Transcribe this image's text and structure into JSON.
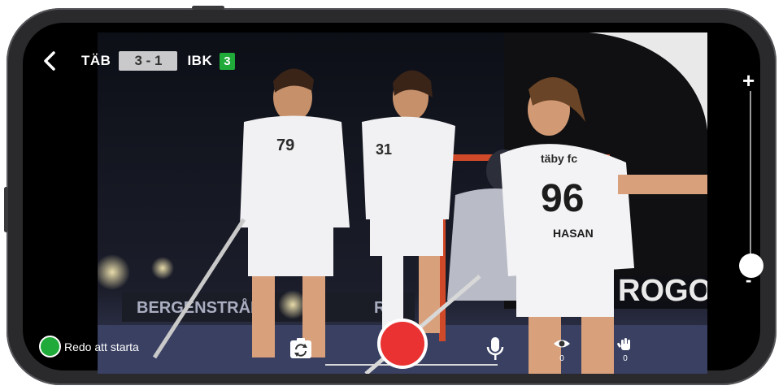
{
  "scoreboard": {
    "home_team": "TÄB",
    "score": "3 - 1",
    "away_team": "IBK",
    "period": "3"
  },
  "status": {
    "label": "Redo att starta",
    "color": "#1faa3a"
  },
  "counters": {
    "viewers": "0",
    "reactions": "0"
  },
  "icons": {
    "back": "chevron-left-icon",
    "switch_camera": "camera-rotate-icon",
    "record": "record-button",
    "mic": "microphone-icon",
    "viewers": "eye-icon",
    "reactions": "hand-icon",
    "zoom_in": "plus-icon",
    "zoom_out": "minus-icon"
  },
  "scene": {
    "jersey_front_left": "79",
    "jersey_middle": "31",
    "jersey_right": "96",
    "jersey_right_name": "HASAN",
    "jersey_right_club": "täby fc",
    "banner_left": "BERGENSTRÅLE",
    "banner_left_tail": "RS",
    "banner_right": "ROGON"
  },
  "zoom": {
    "level": 0.0
  },
  "colors": {
    "record": "#ea3232",
    "status_ok": "#1faa3a",
    "score_bg": "#c9c9cb"
  }
}
